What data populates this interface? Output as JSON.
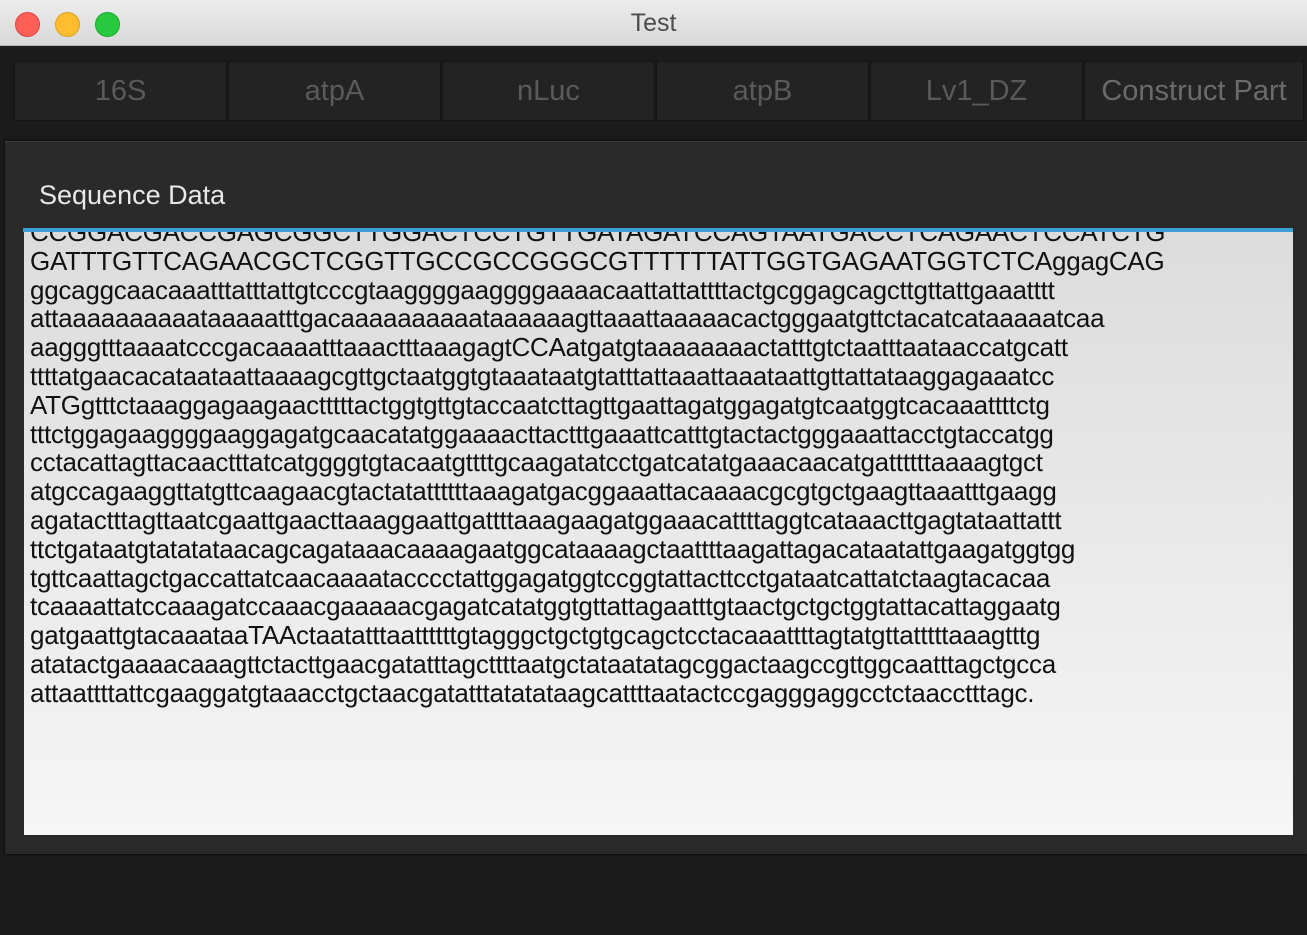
{
  "window": {
    "title": "Test"
  },
  "tabs": [
    {
      "label": "16S"
    },
    {
      "label": "atpA"
    },
    {
      "label": "nLuc"
    },
    {
      "label": "atpB"
    },
    {
      "label": "Lv1_DZ"
    },
    {
      "label": "Construct Part"
    }
  ],
  "panel": {
    "label": "Sequence Data",
    "accent_color": "#3b9fd6"
  },
  "sequence": {
    "lines": [
      "CCGGACGACCGAGCGGCTTGGACTCCTGTTGATAGATCCAGTAATGACCTCAGAACTCCATCTG",
      "GATTTGTTCAGAACGCTCGGTTGCCGCCGGGCGTTTTTTATTGGTGAGAATGGTCTCAggagCAG",
      "ggcaggcaacaaatttatttattgtcccgtaaggggaaggggaaaacaattattattttactgcggagcagcttgttattgaaatttt",
      "attaaaaaaaaaataaaaatttgacaaaaaaaaaataaaaaagttaaattaaaaacactgggaatgttctacatcataaaaatcaa",
      "aagggtttaaaatcccgacaaaatttaaactttaaagagtCCAatgatgtaaaaaaaactatttgtctaatttaataaccatgcatt",
      "ttttatgaacacataataattaaaagcgttgctaatggtgtaaataatgtatttattaaattaaataattgttattataaggagaaatcc",
      "ATGgtttctaaaggagaagaactttttactggtgttgtaccaatcttagttgaattagatggagatgtcaatggtcacaaattttctg",
      "tttctggagaaggggaaggagatgcaacatatggaaaacttactttgaaattcatttgtactactgggaaattacctgtaccatgg",
      "cctacattagttacaactttatcatggggtgtacaatgttttgcaagatatcctgatcatatgaaacaacatgattttttaaaagtgct",
      "atgccagaaggttatgttcaagaacgtactatattttttaaagatgacggaaattacaaaacgcgtgctgaagttaaatttgaagg",
      "agatactttagttaatcgaattgaacttaaaggaattgattttaaagaagatggaaacattttaggtcataaacttgagtataattattt",
      "ttctgataatgtatatataacagcagataaacaaaagaatggcataaaagctaattttaagattagacataatattgaagatggtgg",
      "tgttcaattagctgaccattatcaacaaaatacccctattggagatggtccggtattacttcctgataatcattatctaagtacacaa",
      "tcaaaattatccaaagatccaaacgaaaaacgagatcatatggtgttattagaatttgtaactgctgctggtattacattaggaatg",
      "gatgaattgtacaaataaTAActaatatttaattttttgtagggctgctgtgcagctcctacaaattttagtatgttatttttaaagtttg",
      "atatactgaaaacaaagttctacttgaacgatatttagcttttaatgctataatatagcggactaagccgttggcaatttagctgcca",
      "attaattttattcgaaggatgtaaacctgctaacgatatttatatataagcattttaatactccgagggaggcctctaacctttagc."
    ]
  }
}
